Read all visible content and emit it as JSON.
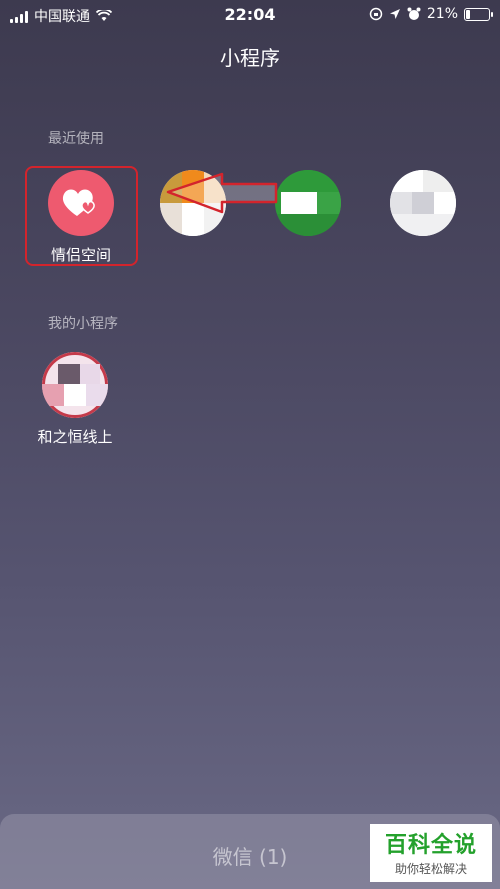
{
  "status_bar": {
    "carrier": "中国联通",
    "time": "22:04",
    "battery": "21%",
    "battery_level": 0.21
  },
  "page": {
    "title": "小程序"
  },
  "recent": {
    "label": "最近使用",
    "apps": [
      {
        "name": "情侣空间",
        "icon": "heart-icon",
        "color": "#ee5a6f"
      },
      {
        "name": "",
        "icon": "blurred-icon"
      },
      {
        "name": "",
        "icon": "blurred-icon"
      },
      {
        "name": "",
        "icon": "blurred-icon"
      }
    ]
  },
  "mine": {
    "label": "我的小程序",
    "apps": [
      {
        "name": "和之恒线上",
        "icon": "blurred-icon"
      }
    ]
  },
  "bottom": {
    "label": "微信 (1)"
  },
  "watermark": {
    "line1": "百科全说",
    "line2": "助你轻松解决"
  },
  "colors": {
    "highlight": "#d3242c",
    "heart_bg": "#ee5a6f",
    "watermark_green": "#24a12c"
  }
}
